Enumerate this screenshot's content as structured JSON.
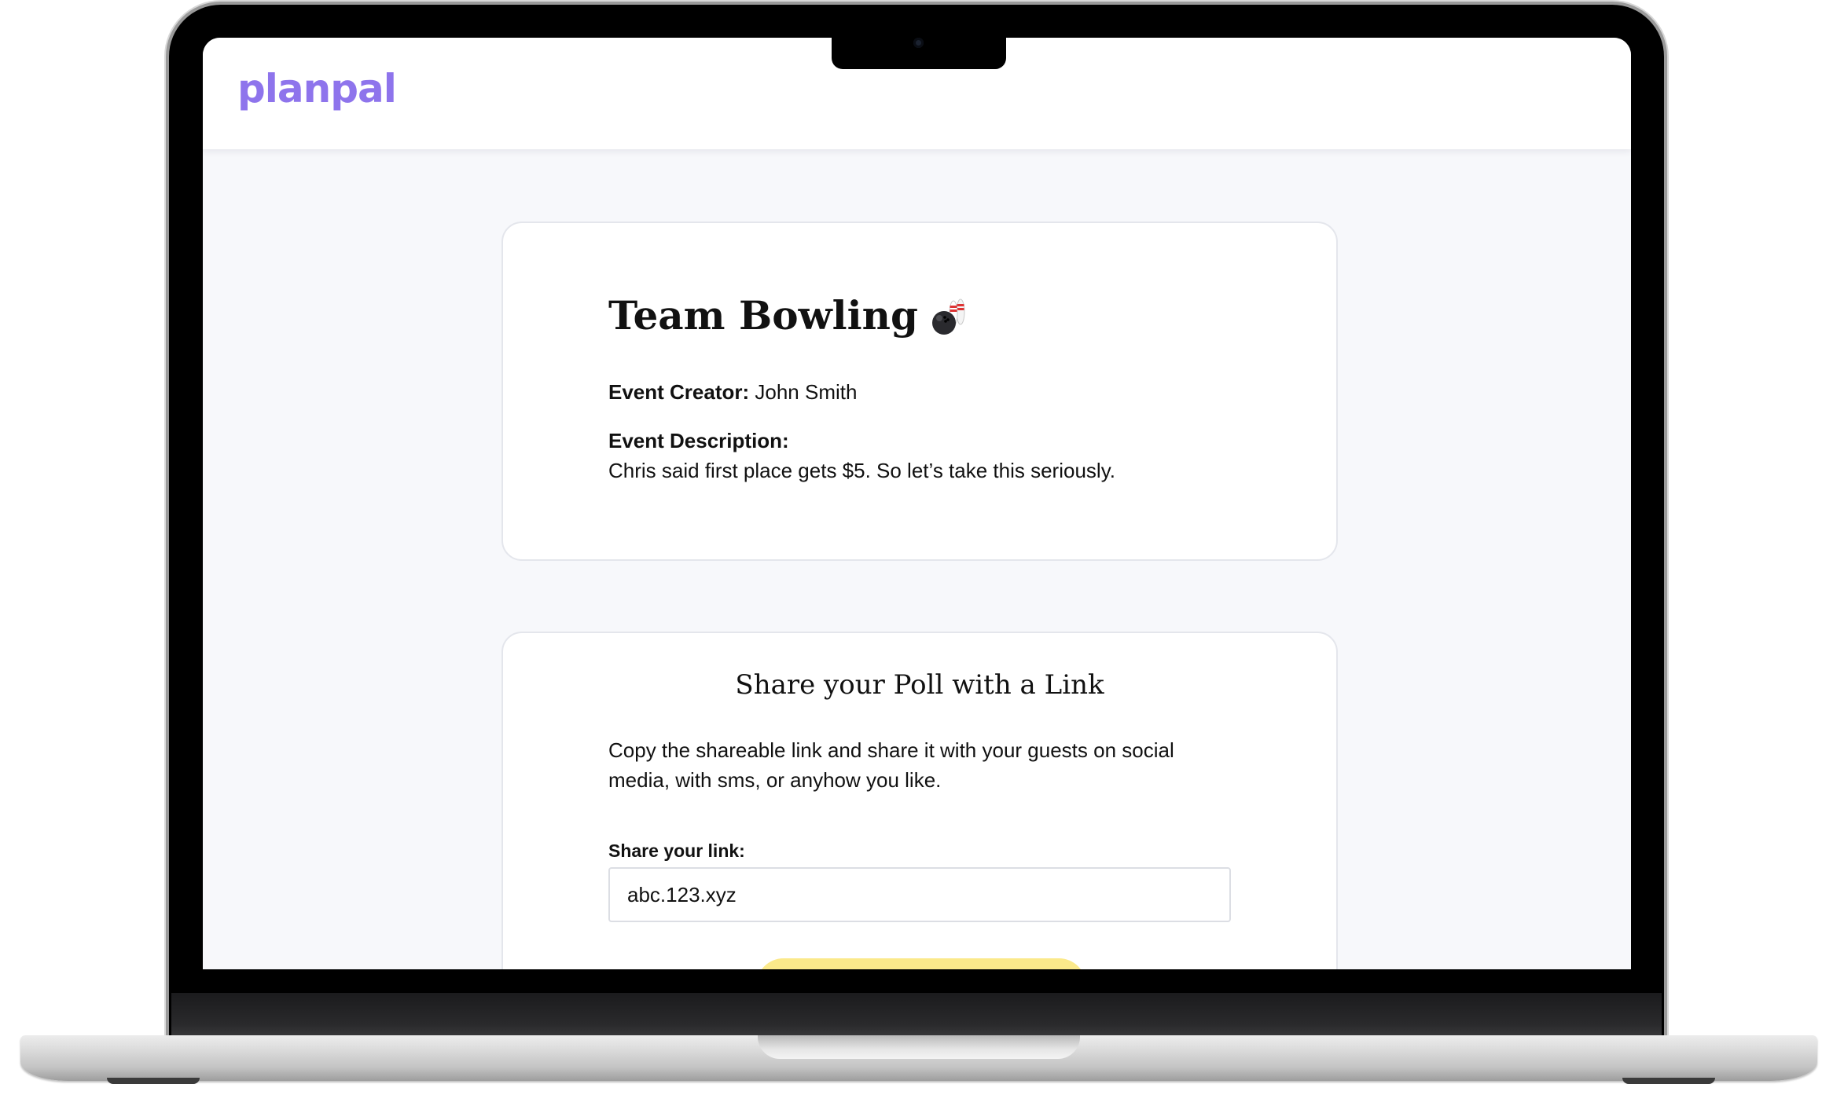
{
  "app": {
    "logo_text": "planpal",
    "brand_color": "#8e74ec",
    "background_color": "#f7f8fb"
  },
  "event": {
    "title": "Team Bowling",
    "title_icon": "bowling-icon",
    "creator_label": "Event Creator:",
    "creator_name": "John Smith",
    "description_label": "Event Description:",
    "description": "Chris said first place gets $5.  So let’s take this seriously."
  },
  "share": {
    "heading": "Share your Poll with a Link",
    "instructions": "Copy the shareable link and share it with your guests on social media, with sms, or anyhow you like.",
    "link_label": "Share your link:",
    "link_value": "abc.123.xyz",
    "copy_button_color": "#fbe98a"
  }
}
